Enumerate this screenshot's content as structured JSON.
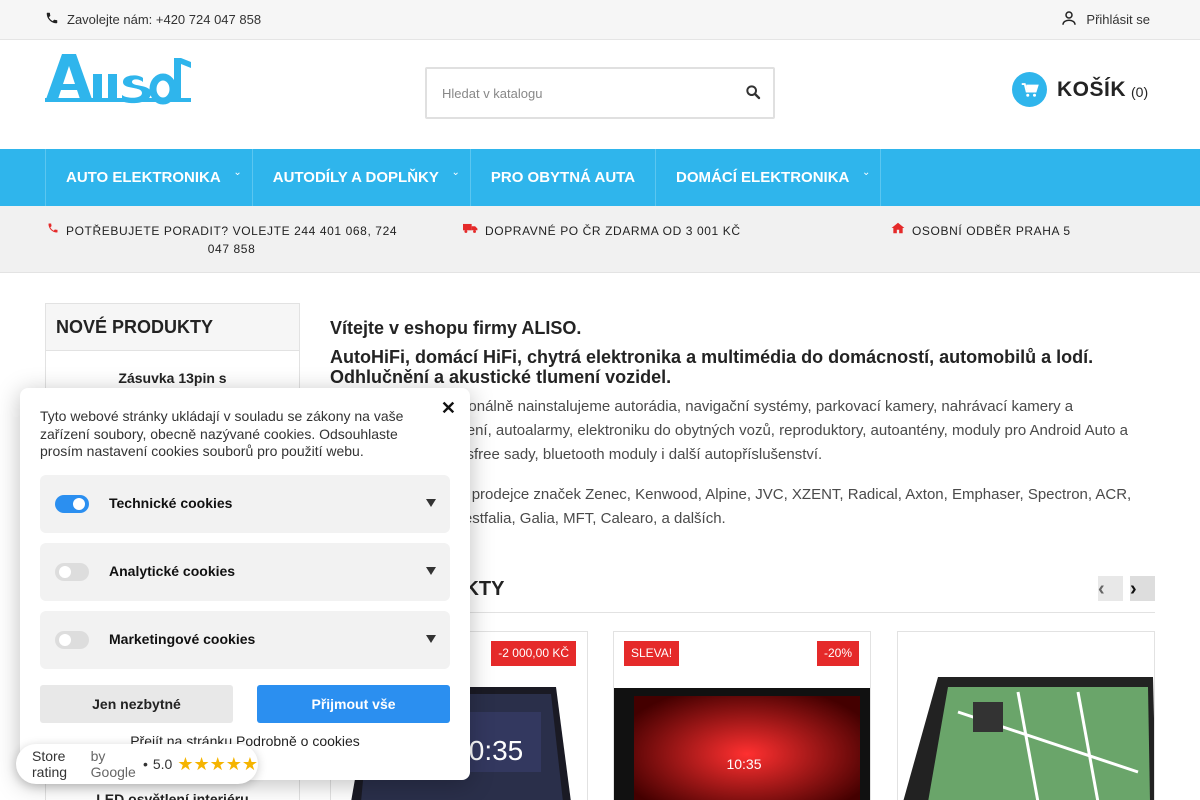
{
  "topbar": {
    "phone_text": "Zavolejte nám: +420 724 047 858",
    "login_label": "Přihlásit se"
  },
  "header": {
    "logo_text": "ALISO",
    "search_placeholder": "Hledat v katalogu",
    "cart_label": "KOŠÍK",
    "cart_count": "(0)"
  },
  "nav": {
    "items": [
      {
        "label": "AUTO ELEKTRONIKA",
        "has_submenu": true
      },
      {
        "label": "AUTODÍLY A DOPLŇKY",
        "has_submenu": true
      },
      {
        "label": "PRO OBYTNÁ AUTA",
        "has_submenu": false
      },
      {
        "label": "DOMÁCÍ ELEKTRONIKA",
        "has_submenu": true
      }
    ]
  },
  "infostrip": {
    "advice_line1": "POTŘEBUJETE PORADIT? VOLEJTE 244 401 068, 724",
    "advice_line2": "047 858",
    "shipping": "DOPRAVNÉ PO ČR ZDARMA OD 3 001 KČ",
    "pickup": "OSOBNÍ ODBĚR PRAHA 5"
  },
  "sidebar": {
    "title": "NOVÉ PRODUKTY",
    "first_product": "Zásuvka 13pin s",
    "last_product": "LED osvětlení interiéru"
  },
  "main": {
    "welcome": "Vítejte v eshopu firmy ALISO.",
    "subtitle": "AutoHiFi, domácí HiFi, chytrá elektronika a multimédia do domácností, automobilů a lodí. Odhlučnění a akustické tlumení vozidel.",
    "para1": "Prodáváme a profesionálně nainstalujeme autorádia, navigační systémy, parkovací kamery, nahrávací kamery a zabezpečovací zařízení, autoalarmy, elektroniku do obytných vozů, reproduktory, autoantény, moduly pro Android Auto a Apple CarPlay, handsfree sady, bluetooth moduly i další autopříslušenství.",
    "para2": "Jsme autorizovaným prodejce značek Zenec, Kenwood, Alpine, JVC, XZENT, Radical, Axton, Emphaser, Spectron, ACR, Dietz, Mobitronic, Westfalia, Galia, MFT, Calearo, a dalších.",
    "section_title": "NOVÉ PRODUKTY"
  },
  "cards": [
    {
      "badges": [],
      "discount": "-2 000,00 KČ"
    },
    {
      "badges": [
        "SLEVA!"
      ],
      "discount": "-20%"
    },
    {
      "badges": [],
      "discount": ""
    }
  ],
  "cookies": {
    "text": "Tyto webové stránky ukládají v souladu se zákony na vaše zařízení soubory, obecně nazývané cookies. Odsouhlaste prosím nastavení cookies souborů pro použití webu.",
    "categories": [
      {
        "label": "Technické cookies",
        "enabled": true
      },
      {
        "label": "Analytické cookies",
        "enabled": false
      },
      {
        "label": "Marketingové cookies",
        "enabled": false
      }
    ],
    "btn_necessary": "Jen nezbytné",
    "btn_accept": "Přijmout vše",
    "details_link": "Přejít na stránku Podrobně o cookies"
  },
  "rating": {
    "label": "Store rating",
    "by": "by Google",
    "sep": "•",
    "score": "5.0",
    "stars": "★★★★★"
  },
  "colors": {
    "accent": "#2fb5ec",
    "badge_red": "#e52a2a",
    "cookie_blue": "#2b8ff0",
    "icon_red": "#e52a2a"
  }
}
